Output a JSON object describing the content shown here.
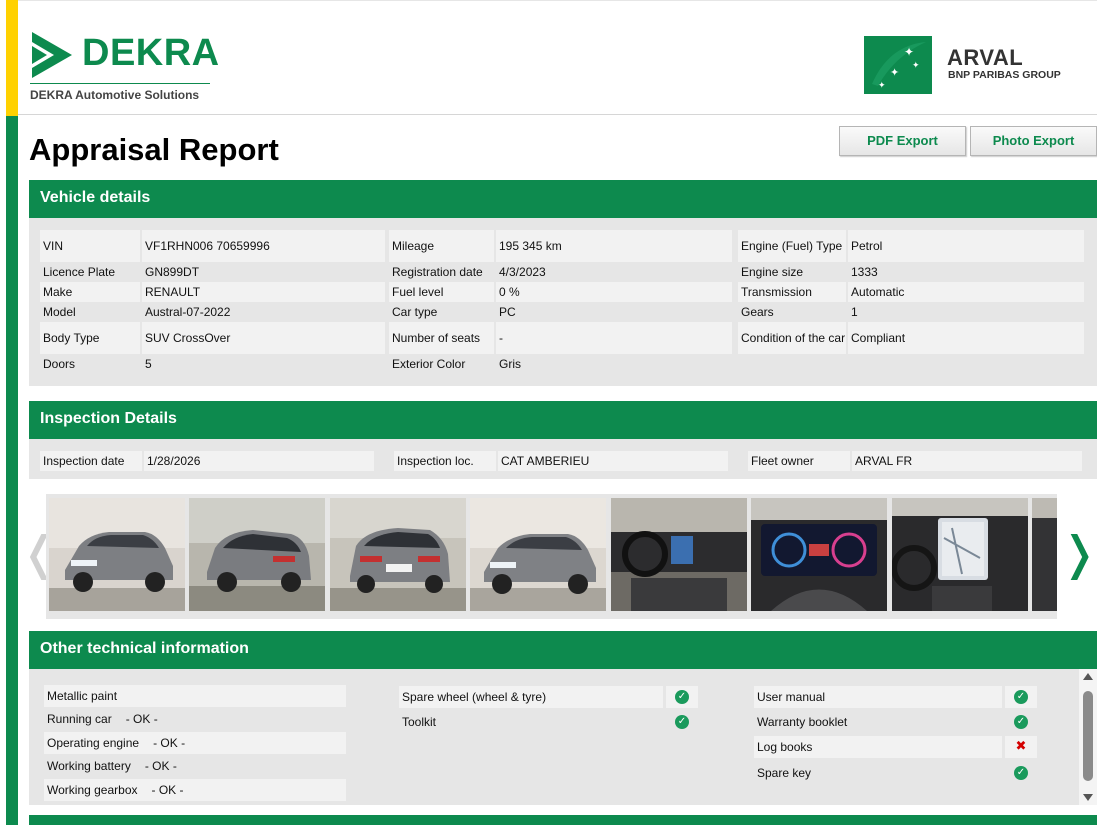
{
  "brand": {
    "dekra_name": "DEKRA",
    "dekra_tagline": "DEKRA Automotive Solutions",
    "arval_name": "ARVAL",
    "arval_tagline": "BNP PARIBAS GROUP",
    "green": "#0d8a4e",
    "yellow": "#ffd100"
  },
  "page_title": "Appraisal Report",
  "actions": {
    "pdf_export": "PDF Export",
    "photo_export": "Photo Export"
  },
  "vehicle": {
    "header": "Vehicle details",
    "columns": [
      [
        {
          "label": "VIN",
          "value": "VF1RHN006 70659996"
        },
        {
          "label": "Licence Plate",
          "value": "GN899DT"
        },
        {
          "label": "Make",
          "value": "RENAULT"
        },
        {
          "label": "Model",
          "value": "Austral-07-2022"
        },
        {
          "label": "Body Type",
          "value": "SUV CrossOver"
        },
        {
          "label": "Doors",
          "value": "5"
        }
      ],
      [
        {
          "label": "Mileage",
          "value": "195 345 km"
        },
        {
          "label": "Registration date",
          "value": "4/3/2023"
        },
        {
          "label": "Fuel level",
          "value": "0 %"
        },
        {
          "label": "Car type",
          "value": "PC"
        },
        {
          "label": "Number of seats",
          "value": "-"
        },
        {
          "label": "Exterior Color",
          "value": "Gris"
        }
      ],
      [
        {
          "label": "Engine (Fuel) Type",
          "value": "Petrol"
        },
        {
          "label": "Engine size",
          "value": "1333"
        },
        {
          "label": "Transmission",
          "value": "Automatic"
        },
        {
          "label": "Gears",
          "value": "1"
        },
        {
          "label": "Condition of the car",
          "value": "Compliant"
        },
        {
          "label": "",
          "value": ""
        }
      ]
    ]
  },
  "inspection": {
    "header": "Inspection Details",
    "fields": [
      {
        "label": "Inspection date",
        "value": "1/28/2026"
      },
      {
        "label": "Inspection loc.",
        "value": "CAT AMBERIEU"
      },
      {
        "label": "Fleet owner",
        "value": "ARVAL FR"
      }
    ],
    "photos": [
      {
        "name": "front-left-exterior-photo"
      },
      {
        "name": "rear-left-exterior-photo"
      },
      {
        "name": "rear-exterior-photo"
      },
      {
        "name": "front-left-exterior-photo-2"
      },
      {
        "name": "dashboard-interior-photo"
      },
      {
        "name": "instrument-cluster-photo"
      },
      {
        "name": "center-screen-photo"
      },
      {
        "name": "interior-photo-partial"
      }
    ]
  },
  "technical": {
    "header": "Other technical information",
    "col1": [
      {
        "label": "Metallic paint",
        "status": ""
      },
      {
        "label": "Running car",
        "status": "- OK -"
      },
      {
        "label": "Operating engine",
        "status": "- OK -"
      },
      {
        "label": "Working battery",
        "status": "- OK -"
      },
      {
        "label": "Working gearbox",
        "status": "- OK -"
      }
    ],
    "col2": [
      {
        "label": "Spare wheel (wheel & tyre)",
        "check": "check-icon"
      },
      {
        "label": "Toolkit",
        "check": "check-icon"
      }
    ],
    "col3": [
      {
        "label": "User manual",
        "check": "check-icon"
      },
      {
        "label": "Warranty booklet",
        "check": "check-icon"
      },
      {
        "label": "Log books",
        "check": "cross-icon"
      },
      {
        "label": "Spare key",
        "check": "check-icon"
      }
    ]
  }
}
